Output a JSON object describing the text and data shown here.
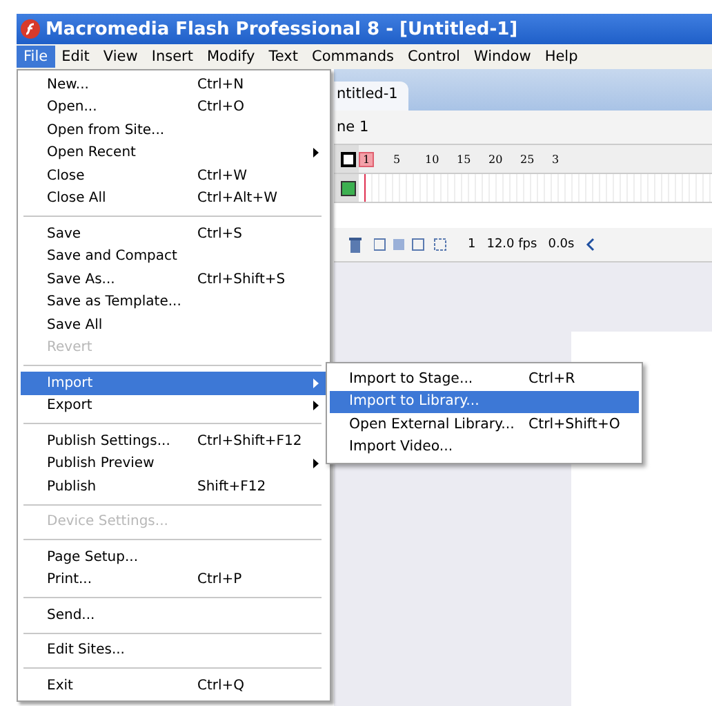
{
  "window": {
    "title": "Macromedia Flash Professional 8 - [Untitled-1]"
  },
  "menubar": [
    {
      "label": "File",
      "selected": true
    },
    {
      "label": "Edit",
      "selected": false
    },
    {
      "label": "View",
      "selected": false
    },
    {
      "label": "Insert",
      "selected": false
    },
    {
      "label": "Modify",
      "selected": false
    },
    {
      "label": "Text",
      "selected": false
    },
    {
      "label": "Commands",
      "selected": false
    },
    {
      "label": "Control",
      "selected": false
    },
    {
      "label": "Window",
      "selected": false
    },
    {
      "label": "Help",
      "selected": false
    }
  ],
  "document": {
    "tab": "ntitled-1",
    "scene": "ne 1",
    "frame_numbers": [
      "1",
      "5",
      "10",
      "15",
      "20",
      "25",
      "3"
    ],
    "current_frame": "1",
    "frame_rate": "12.0 fps",
    "elapsed": "0.0s"
  },
  "file_menu": {
    "items": [
      {
        "kind": "item",
        "label": "New...",
        "shortcut": "Ctrl+N",
        "submenu": false,
        "disabled": false,
        "selected": false
      },
      {
        "kind": "item",
        "label": "Open...",
        "shortcut": "Ctrl+O",
        "submenu": false,
        "disabled": false,
        "selected": false
      },
      {
        "kind": "item",
        "label": "Open from Site...",
        "submenu": false,
        "disabled": false,
        "selected": false
      },
      {
        "kind": "item",
        "label": "Open Recent",
        "submenu": true,
        "disabled": false,
        "selected": false
      },
      {
        "kind": "item",
        "label": "Close",
        "shortcut": "Ctrl+W",
        "submenu": false,
        "disabled": false,
        "selected": false
      },
      {
        "kind": "item",
        "label": "Close All",
        "shortcut": "Ctrl+Alt+W",
        "submenu": false,
        "disabled": false,
        "selected": false
      },
      {
        "kind": "separator"
      },
      {
        "kind": "item",
        "label": "Save",
        "shortcut": "Ctrl+S",
        "submenu": false,
        "disabled": false,
        "selected": false
      },
      {
        "kind": "item",
        "label": "Save and Compact",
        "submenu": false,
        "disabled": false,
        "selected": false
      },
      {
        "kind": "item",
        "label": "Save As...",
        "shortcut": "Ctrl+Shift+S",
        "submenu": false,
        "disabled": false,
        "selected": false
      },
      {
        "kind": "item",
        "label": "Save as Template...",
        "submenu": false,
        "disabled": false,
        "selected": false
      },
      {
        "kind": "item",
        "label": "Save All",
        "submenu": false,
        "disabled": false,
        "selected": false
      },
      {
        "kind": "item",
        "label": "Revert",
        "submenu": false,
        "disabled": true,
        "selected": false
      },
      {
        "kind": "separator"
      },
      {
        "kind": "item",
        "label": "Import",
        "submenu": true,
        "disabled": false,
        "selected": true
      },
      {
        "kind": "item",
        "label": "Export",
        "submenu": true,
        "disabled": false,
        "selected": false
      },
      {
        "kind": "separator"
      },
      {
        "kind": "item",
        "label": "Publish Settings...",
        "shortcut": "Ctrl+Shift+F12",
        "submenu": false,
        "disabled": false,
        "selected": false
      },
      {
        "kind": "item",
        "label": "Publish Preview",
        "submenu": true,
        "disabled": false,
        "selected": false
      },
      {
        "kind": "item",
        "label": "Publish",
        "shortcut": "Shift+F12",
        "submenu": false,
        "disabled": false,
        "selected": false
      },
      {
        "kind": "separator"
      },
      {
        "kind": "item",
        "label": "Device Settings...",
        "submenu": false,
        "disabled": true,
        "selected": false
      },
      {
        "kind": "separator"
      },
      {
        "kind": "item",
        "label": "Page Setup...",
        "submenu": false,
        "disabled": false,
        "selected": false
      },
      {
        "kind": "item",
        "label": "Print...",
        "shortcut": "Ctrl+P",
        "submenu": false,
        "disabled": false,
        "selected": false
      },
      {
        "kind": "separator"
      },
      {
        "kind": "item",
        "label": "Send...",
        "submenu": false,
        "disabled": false,
        "selected": false
      },
      {
        "kind": "separator"
      },
      {
        "kind": "item",
        "label": "Edit Sites...",
        "submenu": false,
        "disabled": false,
        "selected": false
      },
      {
        "kind": "separator"
      },
      {
        "kind": "item",
        "label": "Exit",
        "shortcut": "Ctrl+Q",
        "submenu": false,
        "disabled": false,
        "selected": false
      }
    ]
  },
  "import_submenu": {
    "items": [
      {
        "label": "Import to Stage...",
        "shortcut": "Ctrl+R",
        "selected": false
      },
      {
        "label": "Import to Library...",
        "selected": true
      },
      {
        "label": "Open External Library...",
        "shortcut": "Ctrl+Shift+O",
        "selected": false
      },
      {
        "label": "Import Video...",
        "selected": false
      }
    ]
  }
}
